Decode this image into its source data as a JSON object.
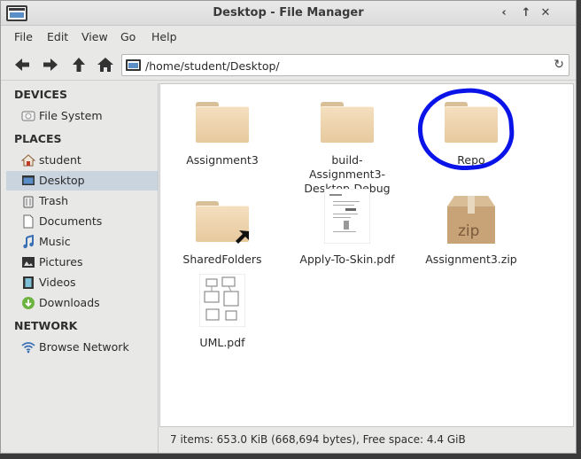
{
  "window": {
    "title": "Desktop - File Manager"
  },
  "window_controls": [
    "‹",
    "↑",
    "✕"
  ],
  "menubar": [
    "File",
    "Edit",
    "View",
    "Go",
    "Help"
  ],
  "toolbar": {
    "address": "/home/student/Desktop/"
  },
  "sidebar": {
    "devices_header": "DEVICES",
    "devices": [
      {
        "label": "File System",
        "icon": "drive-icon"
      }
    ],
    "places_header": "PLACES",
    "places": [
      {
        "label": "student",
        "icon": "home-icon"
      },
      {
        "label": "Desktop",
        "icon": "desktop-icon",
        "active": true
      },
      {
        "label": "Trash",
        "icon": "trash-icon"
      },
      {
        "label": "Documents",
        "icon": "document-icon"
      },
      {
        "label": "Music",
        "icon": "music-icon"
      },
      {
        "label": "Pictures",
        "icon": "pictures-icon"
      },
      {
        "label": "Videos",
        "icon": "video-icon"
      },
      {
        "label": "Downloads",
        "icon": "download-icon"
      }
    ],
    "network_header": "NETWORK",
    "network": [
      {
        "label": "Browse Network",
        "icon": "wifi-icon"
      }
    ]
  },
  "files": [
    {
      "name": "Assignment3",
      "type": "folder"
    },
    {
      "name": "build-Assignment3-Desktop-Debug",
      "type": "folder"
    },
    {
      "name": "Repo",
      "type": "folder"
    },
    {
      "name": "SharedFolders",
      "type": "folder-link"
    },
    {
      "name": "Apply-To-Skin.pdf",
      "type": "pdf"
    },
    {
      "name": "Assignment3.zip",
      "type": "zip"
    },
    {
      "name": "UML.pdf",
      "type": "pdf"
    }
  ],
  "zip_label": "zip",
  "statusbar": {
    "text": "7 items: 653.0 KiB (668,694 bytes), Free space: 4.4 GiB"
  },
  "colors": {
    "selection": "#c9d4df",
    "annotation": "#0a14e8",
    "folder": "#ecd2aa"
  }
}
